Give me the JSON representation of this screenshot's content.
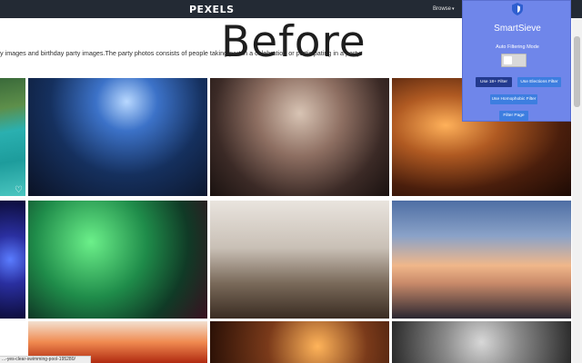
{
  "header": {
    "logo": "PEXELS",
    "browse_label": "Browse",
    "browse_caret": "▾"
  },
  "overlay_label": "Before",
  "description": "y images and birthday party images.The party photos consists of people taking part in a celebration or participating in a party.",
  "photos": [
    {
      "name": "photo-pool",
      "subject": "swimming pool"
    },
    {
      "name": "photo-concert",
      "subject": "concert crowd"
    },
    {
      "name": "photo-confetti",
      "subject": "confetti party"
    },
    {
      "name": "photo-wine",
      "subject": "wine glass"
    },
    {
      "name": "photo-blue-lights",
      "subject": "blue lights"
    },
    {
      "name": "photo-balloons",
      "subject": "balloons"
    },
    {
      "name": "photo-champagne",
      "subject": "champagne glasses"
    },
    {
      "name": "photo-beach",
      "subject": "beach sunset"
    },
    {
      "name": "photo-fire",
      "subject": "fire"
    },
    {
      "name": "photo-bokeh",
      "subject": "glass bokeh"
    },
    {
      "name": "photo-hair",
      "subject": "hair"
    }
  ],
  "status_url": "...-yes-clear-swimming-pool-195280/",
  "extension": {
    "title": "SmartSieve",
    "mode_label": "Auto Filtering Mode",
    "toggle_on": false,
    "buttons": [
      {
        "label": "Use 18+ Filter"
      },
      {
        "label": "Use Elections Filter"
      },
      {
        "label": "Use Homophobic Filter"
      },
      {
        "label": "Filter Page"
      }
    ],
    "colors": {
      "panel": "#6f86ea",
      "button": "#3d7ee0",
      "button_dark": "#233a8e"
    }
  }
}
